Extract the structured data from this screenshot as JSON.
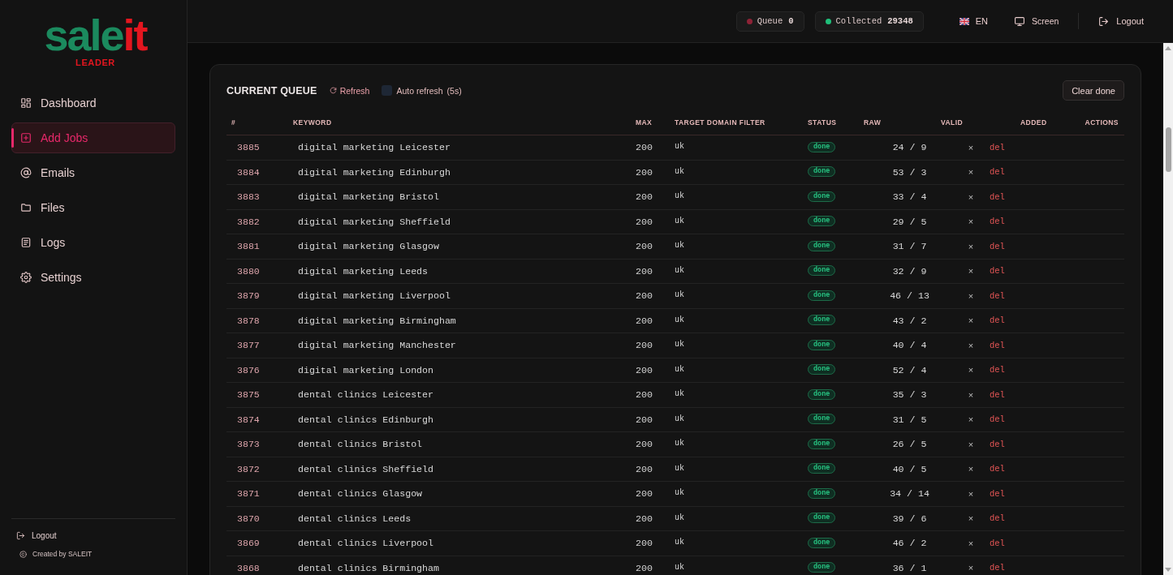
{
  "sidebar": {
    "logo": {
      "parts": [
        "sale",
        "it"
      ],
      "tagline": "LEADER"
    },
    "items": [
      {
        "label": "Dashboard",
        "selected": false
      },
      {
        "label": "Add Jobs",
        "selected": true
      },
      {
        "label": "Emails",
        "selected": false
      },
      {
        "label": "Files",
        "selected": false
      },
      {
        "label": "Logs",
        "selected": false
      },
      {
        "label": "Settings",
        "selected": false
      }
    ],
    "footer": {
      "logout": "Logout",
      "credit": "Created by SALEIT"
    }
  },
  "topbar": {
    "stats": [
      {
        "label": "Queue",
        "value": "0",
        "color": "#8e2236"
      },
      {
        "label": "Collected",
        "value": "29348",
        "color": "#1fbf7a"
      }
    ],
    "language": "EN",
    "screen": "Screen",
    "logout": "Logout"
  },
  "queue": {
    "title": "CURRENT QUEUE",
    "refresh": "Refresh",
    "auto_refresh": {
      "label": "Auto refresh",
      "interval": "(5s)",
      "checked": false
    },
    "clear_button": "Clear done",
    "table": {
      "columns": [
        "#",
        "KEYWORD",
        "MAX",
        "TARGET DOMAIN FILTER",
        "STATUS",
        "RAW",
        "VALID",
        "ADDED",
        "ACTIONS"
      ],
      "rows": [
        {
          "id": "3885",
          "keyword": "digital marketing Leicester",
          "max": "200",
          "domain_filter": "uk",
          "status": "done",
          "raw_valid": "24 / 9",
          "remove": "×",
          "action": "del"
        },
        {
          "id": "3884",
          "keyword": "digital marketing Edinburgh",
          "max": "200",
          "domain_filter": "uk",
          "status": "done",
          "raw_valid": "53 / 3",
          "remove": "×",
          "action": "del"
        },
        {
          "id": "3883",
          "keyword": "digital marketing Bristol",
          "max": "200",
          "domain_filter": "uk",
          "status": "done",
          "raw_valid": "33 / 4",
          "remove": "×",
          "action": "del"
        },
        {
          "id": "3882",
          "keyword": "digital marketing Sheffield",
          "max": "200",
          "domain_filter": "uk",
          "status": "done",
          "raw_valid": "29 / 5",
          "remove": "×",
          "action": "del"
        },
        {
          "id": "3881",
          "keyword": "digital marketing Glasgow",
          "max": "200",
          "domain_filter": "uk",
          "status": "done",
          "raw_valid": "31 / 7",
          "remove": "×",
          "action": "del"
        },
        {
          "id": "3880",
          "keyword": "digital marketing Leeds",
          "max": "200",
          "domain_filter": "uk",
          "status": "done",
          "raw_valid": "32 / 9",
          "remove": "×",
          "action": "del"
        },
        {
          "id": "3879",
          "keyword": "digital marketing Liverpool",
          "max": "200",
          "domain_filter": "uk",
          "status": "done",
          "raw_valid": "46 / 13",
          "remove": "×",
          "action": "del"
        },
        {
          "id": "3878",
          "keyword": "digital marketing Birmingham",
          "max": "200",
          "domain_filter": "uk",
          "status": "done",
          "raw_valid": "43 / 2",
          "remove": "×",
          "action": "del"
        },
        {
          "id": "3877",
          "keyword": "digital marketing Manchester",
          "max": "200",
          "domain_filter": "uk",
          "status": "done",
          "raw_valid": "40 / 4",
          "remove": "×",
          "action": "del"
        },
        {
          "id": "3876",
          "keyword": "digital marketing London",
          "max": "200",
          "domain_filter": "uk",
          "status": "done",
          "raw_valid": "52 / 4",
          "remove": "×",
          "action": "del"
        },
        {
          "id": "3875",
          "keyword": "dental clinics Leicester",
          "max": "200",
          "domain_filter": "uk",
          "status": "done",
          "raw_valid": "35 / 3",
          "remove": "×",
          "action": "del"
        },
        {
          "id": "3874",
          "keyword": "dental clinics Edinburgh",
          "max": "200",
          "domain_filter": "uk",
          "status": "done",
          "raw_valid": "31 / 5",
          "remove": "×",
          "action": "del"
        },
        {
          "id": "3873",
          "keyword": "dental clinics Bristol",
          "max": "200",
          "domain_filter": "uk",
          "status": "done",
          "raw_valid": "26 / 5",
          "remove": "×",
          "action": "del"
        },
        {
          "id": "3872",
          "keyword": "dental clinics Sheffield",
          "max": "200",
          "domain_filter": "uk",
          "status": "done",
          "raw_valid": "40 / 5",
          "remove": "×",
          "action": "del"
        },
        {
          "id": "3871",
          "keyword": "dental clinics Glasgow",
          "max": "200",
          "domain_filter": "uk",
          "status": "done",
          "raw_valid": "34 / 14",
          "remove": "×",
          "action": "del"
        },
        {
          "id": "3870",
          "keyword": "dental clinics Leeds",
          "max": "200",
          "domain_filter": "uk",
          "status": "done",
          "raw_valid": "39 / 6",
          "remove": "×",
          "action": "del"
        },
        {
          "id": "3869",
          "keyword": "dental clinics Liverpool",
          "max": "200",
          "domain_filter": "uk",
          "status": "done",
          "raw_valid": "46 / 2",
          "remove": "×",
          "action": "del"
        },
        {
          "id": "3868",
          "keyword": "dental clinics Birmingham",
          "max": "200",
          "domain_filter": "uk",
          "status": "done",
          "raw_valid": "36 / 1",
          "remove": "×",
          "action": "del"
        }
      ]
    }
  }
}
